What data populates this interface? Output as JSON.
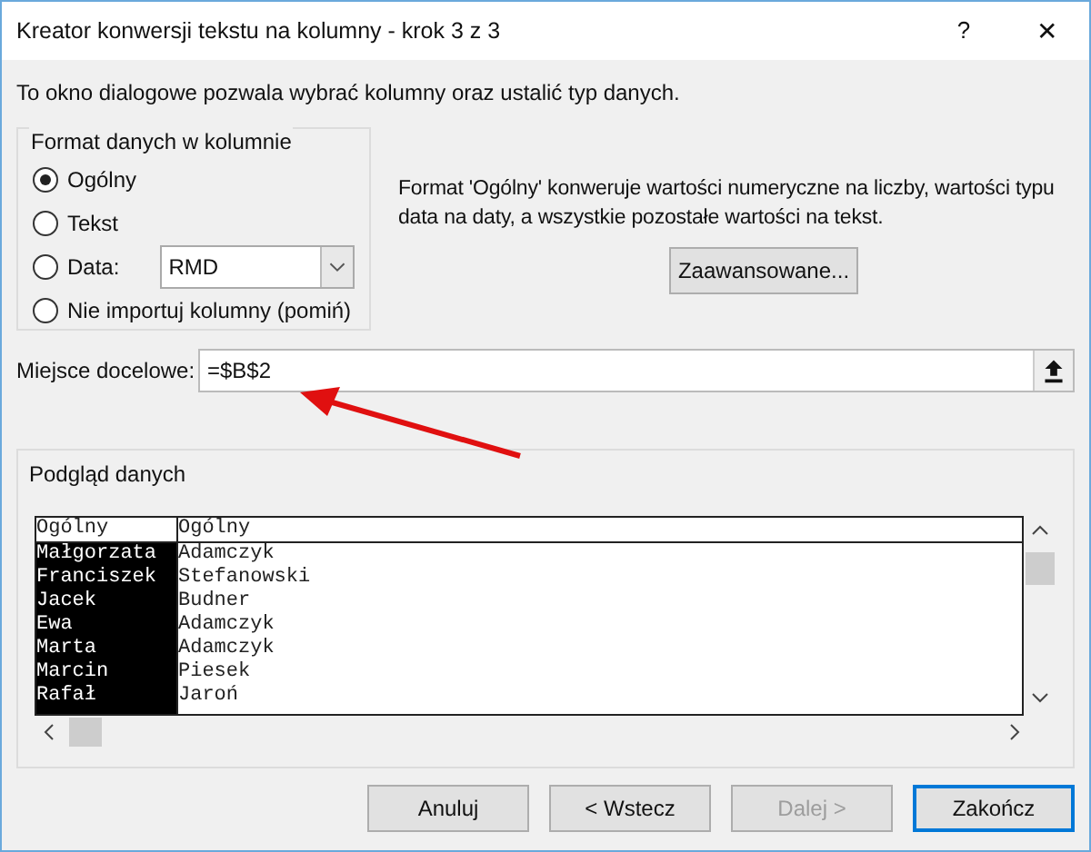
{
  "window": {
    "title": "Kreator konwersji tekstu na kolumny - krok 3 z 3",
    "help": "?",
    "close": "✕"
  },
  "intro": "To okno dialogowe pozwala wybrać kolumny oraz ustalić typ danych.",
  "format_group": {
    "title": "Format danych w kolumnie",
    "options": [
      {
        "kind": "radio",
        "label": "Ogólny",
        "selected": true
      },
      {
        "kind": "radio",
        "label": "Tekst",
        "selected": false
      },
      {
        "kind": "select",
        "label": "Data:",
        "selected": false,
        "value": "RMD"
      },
      {
        "kind": "radio",
        "label": "Nie importuj kolumny (pomiń)",
        "selected": false
      }
    ]
  },
  "description": "Format 'Ogólny' konweruje wartości numeryczne na liczby, wartości typu data na daty, a wszystkie pozostałe wartości na tekst.",
  "advanced_button": "Zaawansowane...",
  "destination": {
    "label": "Miejsce docelowe:",
    "value": "=$B$2"
  },
  "preview": {
    "title": "Podgląd danych",
    "columns": [
      {
        "header": "Ogólny",
        "selected": true
      },
      {
        "header": "Ogólny",
        "selected": false
      }
    ],
    "rows": [
      [
        "Małgorzata",
        "Adamczyk"
      ],
      [
        "Franciszek",
        "Stefanowski"
      ],
      [
        "Jacek",
        "Budner"
      ],
      [
        "Ewa",
        "Adamczyk"
      ],
      [
        "Marta",
        "Adamczyk"
      ],
      [
        "Marcin",
        "Piesek"
      ],
      [
        "Rafał",
        "Jaroń"
      ]
    ]
  },
  "buttons": [
    {
      "label": "Anuluj",
      "disabled": false,
      "default": false
    },
    {
      "label": "< Wstecz",
      "disabled": false,
      "default": false
    },
    {
      "label": "Dalej >",
      "disabled": true,
      "default": false
    },
    {
      "label": "Zakończ",
      "disabled": false,
      "default": true
    }
  ]
}
